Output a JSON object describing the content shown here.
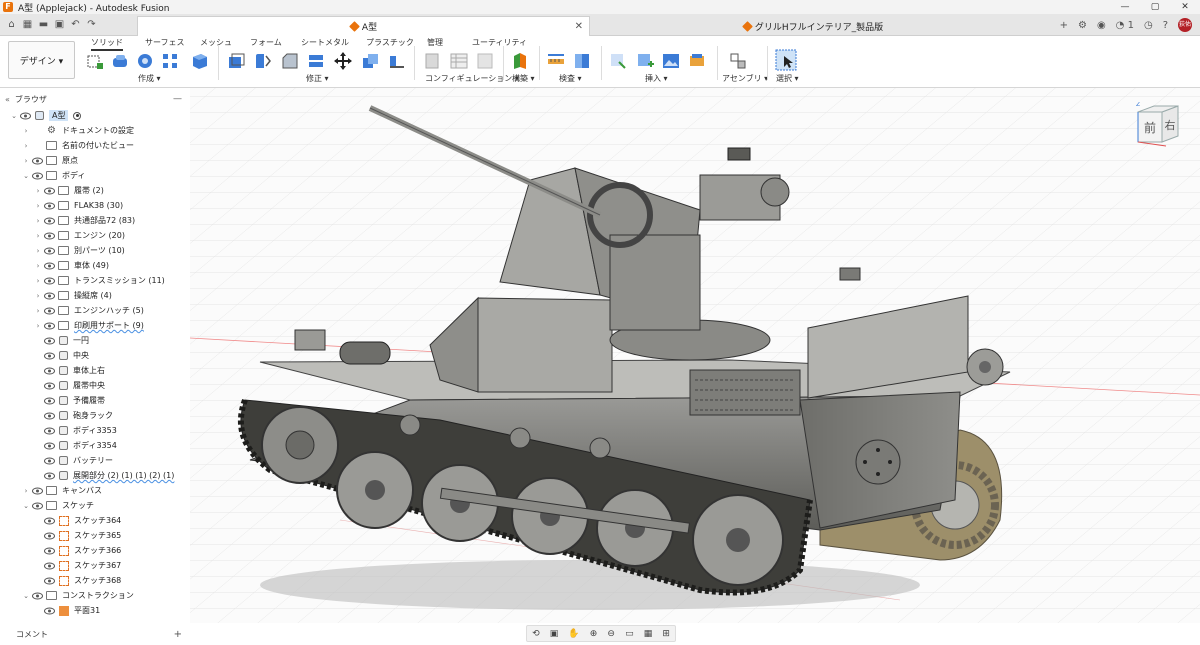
{
  "window": {
    "title": "A型 (Applejack) - Autodesk Fusion",
    "logo_letter": "F",
    "controls": [
      "—",
      "▢",
      "✕"
    ]
  },
  "quick_access": {
    "icons": [
      "home-icon",
      "grid-icon",
      "file-icon",
      "save-icon",
      "undo-icon",
      "redo-icon"
    ]
  },
  "tabs": {
    "active": {
      "label": "A型",
      "close": "✕"
    },
    "inactive": {
      "label": "グリルHフルインテリア_製品版"
    },
    "add": "+"
  },
  "top_right": {
    "job_count": "1",
    "avatar_text": "荻佑"
  },
  "toolbar": {
    "workspace": "デザイン ▾",
    "tabs": [
      "ソリッド",
      "サーフェス",
      "メッシュ",
      "フォーム",
      "シートメタル",
      "プラスチック",
      "管理",
      "ユーティリティ"
    ],
    "groups": [
      "作成 ▾",
      "修正 ▾",
      "コンフィギュレーション ▾",
      "構築 ▾",
      "検査 ▾",
      "挿入 ▾",
      "アセンブリ ▾",
      "選択 ▾"
    ]
  },
  "browser": {
    "title": "ブラウザ",
    "collapse": "«",
    "minimize": "—",
    "root": "A型",
    "items": [
      {
        "label": "ドキュメントの設定",
        "level": 1,
        "icon": "gear",
        "arrow": "›",
        "eye": false
      },
      {
        "label": "名前の付いたビュー",
        "level": 1,
        "icon": "folder",
        "arrow": "›",
        "eye": false
      },
      {
        "label": "原点",
        "level": 1,
        "icon": "folder",
        "arrow": "›",
        "eye": true
      },
      {
        "label": "ボディ",
        "level": 1,
        "icon": "folder",
        "arrow": "⌄",
        "eye": true
      },
      {
        "label": "履帯 (2)",
        "level": 2,
        "icon": "folder",
        "arrow": "›",
        "eye": true
      },
      {
        "label": "FLAK38 (30)",
        "level": 2,
        "icon": "folder",
        "arrow": "›",
        "eye": true
      },
      {
        "label": "共通部品72 (83)",
        "level": 2,
        "icon": "folder",
        "arrow": "›",
        "eye": true
      },
      {
        "label": "エンジン (20)",
        "level": 2,
        "icon": "folder",
        "arrow": "›",
        "eye": true
      },
      {
        "label": "別パーツ (10)",
        "level": 2,
        "icon": "folder",
        "arrow": "›",
        "eye": true
      },
      {
        "label": "車体 (49)",
        "level": 2,
        "icon": "folder",
        "arrow": "›",
        "eye": true
      },
      {
        "label": "トランスミッション (11)",
        "level": 2,
        "icon": "folder",
        "arrow": "›",
        "eye": true
      },
      {
        "label": "操縦席 (4)",
        "level": 2,
        "icon": "folder",
        "arrow": "›",
        "eye": true
      },
      {
        "label": "エンジンハッチ (5)",
        "level": 2,
        "icon": "folder",
        "arrow": "›",
        "eye": true
      },
      {
        "label": "印刷用サポート (9)",
        "level": 2,
        "icon": "folder",
        "arrow": "›",
        "eye": true,
        "wavy": true
      },
      {
        "label": "一円",
        "level": 2,
        "icon": "body",
        "eye": true
      },
      {
        "label": "中央",
        "level": 2,
        "icon": "body",
        "eye": true
      },
      {
        "label": "車体上右",
        "level": 2,
        "icon": "body",
        "eye": true
      },
      {
        "label": "履帯中央",
        "level": 2,
        "icon": "body",
        "eye": true
      },
      {
        "label": "予備履帯",
        "level": 2,
        "icon": "body",
        "eye": true
      },
      {
        "label": "砲身ラック",
        "level": 2,
        "icon": "body",
        "eye": true
      },
      {
        "label": "ボディ3353",
        "level": 2,
        "icon": "body",
        "eye": true
      },
      {
        "label": "ボディ3354",
        "level": 2,
        "icon": "body",
        "eye": true
      },
      {
        "label": "バッテリー",
        "level": 2,
        "icon": "body",
        "eye": true
      },
      {
        "label": "展開部分 (2) (1) (1) (2) (1)",
        "level": 2,
        "icon": "body",
        "eye": true,
        "wavy": true
      },
      {
        "label": "キャンバス",
        "level": 1,
        "icon": "folder",
        "arrow": "›",
        "eye": true
      },
      {
        "label": "スケッチ",
        "level": 1,
        "icon": "folder",
        "arrow": "⌄",
        "eye": true
      },
      {
        "label": "スケッチ364",
        "level": 2,
        "icon": "sketch",
        "eye": true
      },
      {
        "label": "スケッチ365",
        "level": 2,
        "icon": "sketch",
        "eye": true
      },
      {
        "label": "スケッチ366",
        "level": 2,
        "icon": "sketch",
        "eye": true
      },
      {
        "label": "スケッチ367",
        "level": 2,
        "icon": "sketch",
        "eye": true
      },
      {
        "label": "スケッチ368",
        "level": 2,
        "icon": "sketch",
        "eye": true
      },
      {
        "label": "コンストラクション",
        "level": 1,
        "icon": "folder",
        "arrow": "⌄",
        "eye": true
      },
      {
        "label": "平面31",
        "level": 2,
        "icon": "plane",
        "eye": true
      }
    ]
  },
  "comments": {
    "label": "コメント",
    "plus": "+"
  },
  "viewcube": {
    "front": "前",
    "right": "右",
    "z_axis": "Z"
  },
  "nav_icons": [
    "orbit-icon",
    "look-at-icon",
    "pan-icon",
    "zoom-fit-icon",
    "zoom-icon",
    "display-settings-icon",
    "grid-settings-icon",
    "viewports-icon"
  ]
}
